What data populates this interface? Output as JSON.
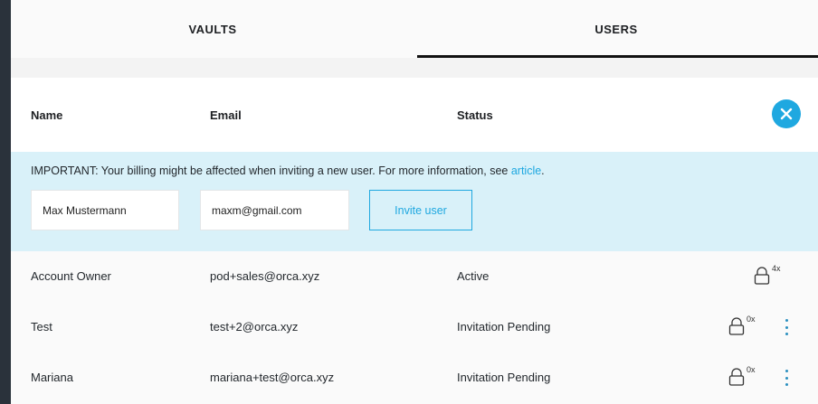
{
  "tabs": [
    {
      "label": "VAULTS",
      "active": false
    },
    {
      "label": "USERS",
      "active": true
    }
  ],
  "table_header": {
    "name": "Name",
    "email": "Email",
    "status": "Status"
  },
  "close_icon": "close-icon",
  "invite": {
    "notice_text": "IMPORTANT: Your billing might be affected when inviting a new user. For more information, see ",
    "notice_link": "article",
    "notice_end": ".",
    "name_value": "Max Mustermann",
    "email_value": "maxm@gmail.com",
    "button_label": "Invite user"
  },
  "users": [
    {
      "name": "Account Owner",
      "email": "pod+sales@orca.xyz",
      "status": "Active",
      "vault_count": "4x",
      "has_menu": false
    },
    {
      "name": "Test",
      "email": "test+2@orca.xyz",
      "status": "Invitation Pending",
      "vault_count": "0x",
      "has_menu": true
    },
    {
      "name": "Mariana",
      "email": "mariana+test@orca.xyz",
      "status": "Invitation Pending",
      "vault_count": "0x",
      "has_menu": true
    }
  ],
  "colors": {
    "accent": "#1fa8e0",
    "invite_bg": "#d9f1f9",
    "frame": "#2a323b"
  }
}
